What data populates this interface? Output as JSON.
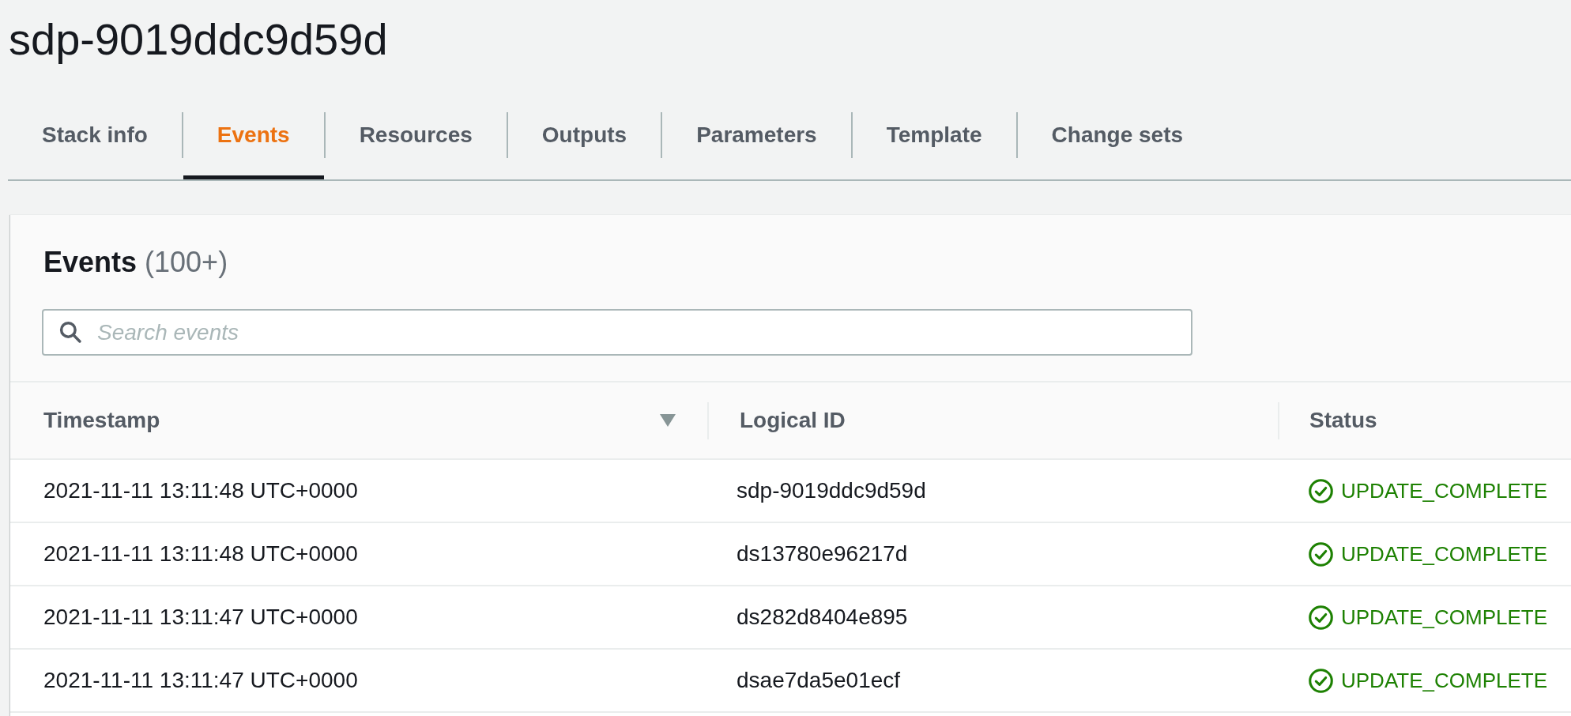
{
  "title": "sdp-9019ddc9d59d",
  "tabs": [
    {
      "label": "Stack info",
      "selected": false
    },
    {
      "label": "Events",
      "selected": true
    },
    {
      "label": "Resources",
      "selected": false
    },
    {
      "label": "Outputs",
      "selected": false
    },
    {
      "label": "Parameters",
      "selected": false
    },
    {
      "label": "Template",
      "selected": false
    },
    {
      "label": "Change sets",
      "selected": false
    }
  ],
  "events_panel": {
    "heading": "Events",
    "count": "(100+)",
    "search": {
      "placeholder": "Search events"
    },
    "table": {
      "columns": [
        {
          "label": "Timestamp",
          "kind": "text",
          "sorted": true
        },
        {
          "label": "Logical ID",
          "kind": "text",
          "sorted": false
        },
        {
          "label": "Status",
          "kind": "status",
          "sorted": false
        }
      ],
      "rows": [
        {
          "cells": [
            "2021-11-11 13:11:48 UTC+0000",
            "sdp-9019ddc9d59d",
            "UPDATE_COMPLETE"
          ]
        },
        {
          "cells": [
            "2021-11-11 13:11:48 UTC+0000",
            "ds13780e96217d",
            "UPDATE_COMPLETE"
          ]
        },
        {
          "cells": [
            "2021-11-11 13:11:47 UTC+0000",
            "ds282d8404e895",
            "UPDATE_COMPLETE"
          ]
        },
        {
          "cells": [
            "2021-11-11 13:11:47 UTC+0000",
            "dsae7da5e01ecf",
            "UPDATE_COMPLETE"
          ]
        }
      ]
    }
  }
}
